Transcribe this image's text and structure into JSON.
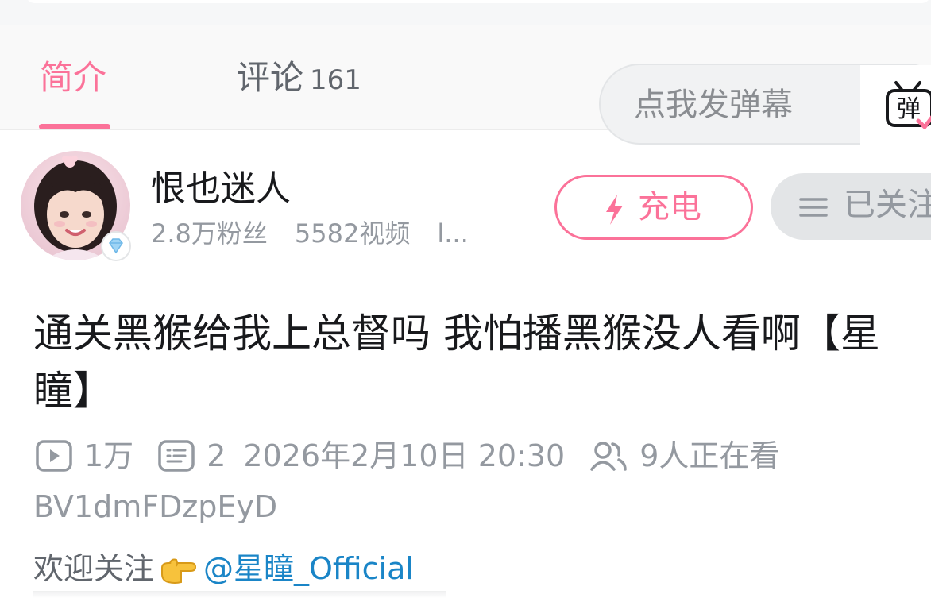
{
  "tabs": {
    "intro_label": "简介",
    "comments_label": "评论",
    "comments_count": "161"
  },
  "danmaku": {
    "placeholder": "点我发弹幕",
    "toggle_icon_text": "弹"
  },
  "uploader": {
    "name": "恨也迷人",
    "fans": "2.8万粉丝",
    "videos": "5582视频",
    "more": "l..."
  },
  "actions": {
    "charge_label": "充电",
    "follow_label": "已关注"
  },
  "video": {
    "title": "通关黑猴给我上总督吗 我怕播黑猴没人看啊【星瞳】",
    "views": "1万",
    "danmaku_count": "2",
    "publish_time": "2026年2月10日 20:30",
    "watching": "9人正在看",
    "bvid": "BV1dmFDzpEyD"
  },
  "description": {
    "prefix": "欢迎关注",
    "mention": "@星瞳_Official"
  },
  "colors": {
    "accent": "#fb7299",
    "link": "#1a85c7",
    "muted": "#9499a0"
  }
}
